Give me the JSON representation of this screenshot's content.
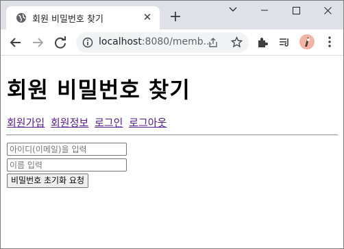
{
  "browser": {
    "tab_title": "회원 비밀번호 찾기",
    "new_tab_symbol": "+",
    "close_symbol": "✕",
    "url_host": "localhost",
    "url_rest": ":8080/memb..."
  },
  "page": {
    "heading": "회원 비밀번호 찾기",
    "nav": [
      {
        "label": "회원가입"
      },
      {
        "label": "회원정보"
      },
      {
        "label": "로그인"
      },
      {
        "label": "로그아웃"
      }
    ],
    "form": {
      "id_placeholder": "아이디(이메일)을 입력",
      "name_placeholder": "이름 입력",
      "submit_label": "비밀번호 초기화 요청"
    }
  },
  "colors": {
    "tabstrip": "#dee1e6",
    "link_visited": "#551a8b",
    "omnibox": "#f1f3f4"
  }
}
